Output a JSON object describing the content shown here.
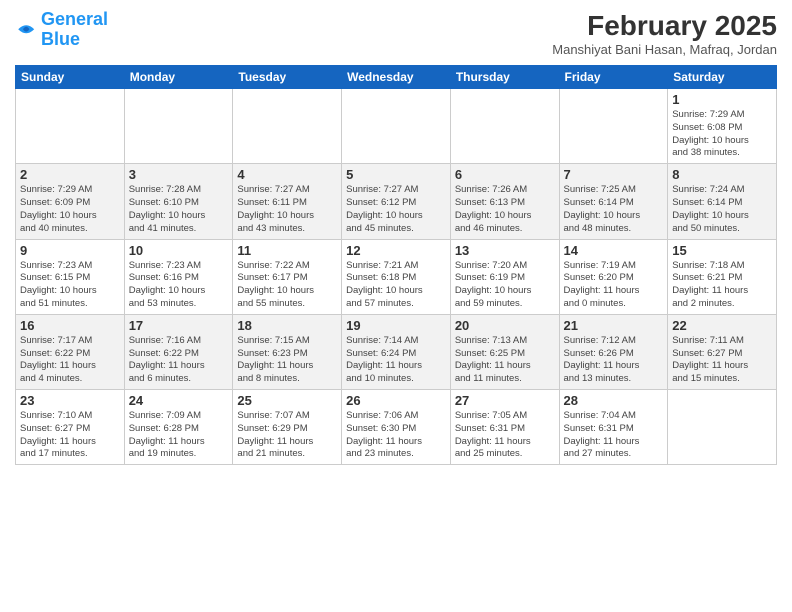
{
  "header": {
    "logo_line1": "General",
    "logo_line2": "Blue",
    "title": "February 2025",
    "subtitle": "Manshiyat Bani Hasan, Mafraq, Jordan"
  },
  "weekdays": [
    "Sunday",
    "Monday",
    "Tuesday",
    "Wednesday",
    "Thursday",
    "Friday",
    "Saturday"
  ],
  "weeks": [
    [
      {
        "day": "",
        "info": ""
      },
      {
        "day": "",
        "info": ""
      },
      {
        "day": "",
        "info": ""
      },
      {
        "day": "",
        "info": ""
      },
      {
        "day": "",
        "info": ""
      },
      {
        "day": "",
        "info": ""
      },
      {
        "day": "1",
        "info": "Sunrise: 7:29 AM\nSunset: 6:08 PM\nDaylight: 10 hours\nand 38 minutes."
      }
    ],
    [
      {
        "day": "2",
        "info": "Sunrise: 7:29 AM\nSunset: 6:09 PM\nDaylight: 10 hours\nand 40 minutes."
      },
      {
        "day": "3",
        "info": "Sunrise: 7:28 AM\nSunset: 6:10 PM\nDaylight: 10 hours\nand 41 minutes."
      },
      {
        "day": "4",
        "info": "Sunrise: 7:27 AM\nSunset: 6:11 PM\nDaylight: 10 hours\nand 43 minutes."
      },
      {
        "day": "5",
        "info": "Sunrise: 7:27 AM\nSunset: 6:12 PM\nDaylight: 10 hours\nand 45 minutes."
      },
      {
        "day": "6",
        "info": "Sunrise: 7:26 AM\nSunset: 6:13 PM\nDaylight: 10 hours\nand 46 minutes."
      },
      {
        "day": "7",
        "info": "Sunrise: 7:25 AM\nSunset: 6:14 PM\nDaylight: 10 hours\nand 48 minutes."
      },
      {
        "day": "8",
        "info": "Sunrise: 7:24 AM\nSunset: 6:14 PM\nDaylight: 10 hours\nand 50 minutes."
      }
    ],
    [
      {
        "day": "9",
        "info": "Sunrise: 7:23 AM\nSunset: 6:15 PM\nDaylight: 10 hours\nand 51 minutes."
      },
      {
        "day": "10",
        "info": "Sunrise: 7:23 AM\nSunset: 6:16 PM\nDaylight: 10 hours\nand 53 minutes."
      },
      {
        "day": "11",
        "info": "Sunrise: 7:22 AM\nSunset: 6:17 PM\nDaylight: 10 hours\nand 55 minutes."
      },
      {
        "day": "12",
        "info": "Sunrise: 7:21 AM\nSunset: 6:18 PM\nDaylight: 10 hours\nand 57 minutes."
      },
      {
        "day": "13",
        "info": "Sunrise: 7:20 AM\nSunset: 6:19 PM\nDaylight: 10 hours\nand 59 minutes."
      },
      {
        "day": "14",
        "info": "Sunrise: 7:19 AM\nSunset: 6:20 PM\nDaylight: 11 hours\nand 0 minutes."
      },
      {
        "day": "15",
        "info": "Sunrise: 7:18 AM\nSunset: 6:21 PM\nDaylight: 11 hours\nand 2 minutes."
      }
    ],
    [
      {
        "day": "16",
        "info": "Sunrise: 7:17 AM\nSunset: 6:22 PM\nDaylight: 11 hours\nand 4 minutes."
      },
      {
        "day": "17",
        "info": "Sunrise: 7:16 AM\nSunset: 6:22 PM\nDaylight: 11 hours\nand 6 minutes."
      },
      {
        "day": "18",
        "info": "Sunrise: 7:15 AM\nSunset: 6:23 PM\nDaylight: 11 hours\nand 8 minutes."
      },
      {
        "day": "19",
        "info": "Sunrise: 7:14 AM\nSunset: 6:24 PM\nDaylight: 11 hours\nand 10 minutes."
      },
      {
        "day": "20",
        "info": "Sunrise: 7:13 AM\nSunset: 6:25 PM\nDaylight: 11 hours\nand 11 minutes."
      },
      {
        "day": "21",
        "info": "Sunrise: 7:12 AM\nSunset: 6:26 PM\nDaylight: 11 hours\nand 13 minutes."
      },
      {
        "day": "22",
        "info": "Sunrise: 7:11 AM\nSunset: 6:27 PM\nDaylight: 11 hours\nand 15 minutes."
      }
    ],
    [
      {
        "day": "23",
        "info": "Sunrise: 7:10 AM\nSunset: 6:27 PM\nDaylight: 11 hours\nand 17 minutes."
      },
      {
        "day": "24",
        "info": "Sunrise: 7:09 AM\nSunset: 6:28 PM\nDaylight: 11 hours\nand 19 minutes."
      },
      {
        "day": "25",
        "info": "Sunrise: 7:07 AM\nSunset: 6:29 PM\nDaylight: 11 hours\nand 21 minutes."
      },
      {
        "day": "26",
        "info": "Sunrise: 7:06 AM\nSunset: 6:30 PM\nDaylight: 11 hours\nand 23 minutes."
      },
      {
        "day": "27",
        "info": "Sunrise: 7:05 AM\nSunset: 6:31 PM\nDaylight: 11 hours\nand 25 minutes."
      },
      {
        "day": "28",
        "info": "Sunrise: 7:04 AM\nSunset: 6:31 PM\nDaylight: 11 hours\nand 27 minutes."
      },
      {
        "day": "",
        "info": ""
      }
    ]
  ]
}
